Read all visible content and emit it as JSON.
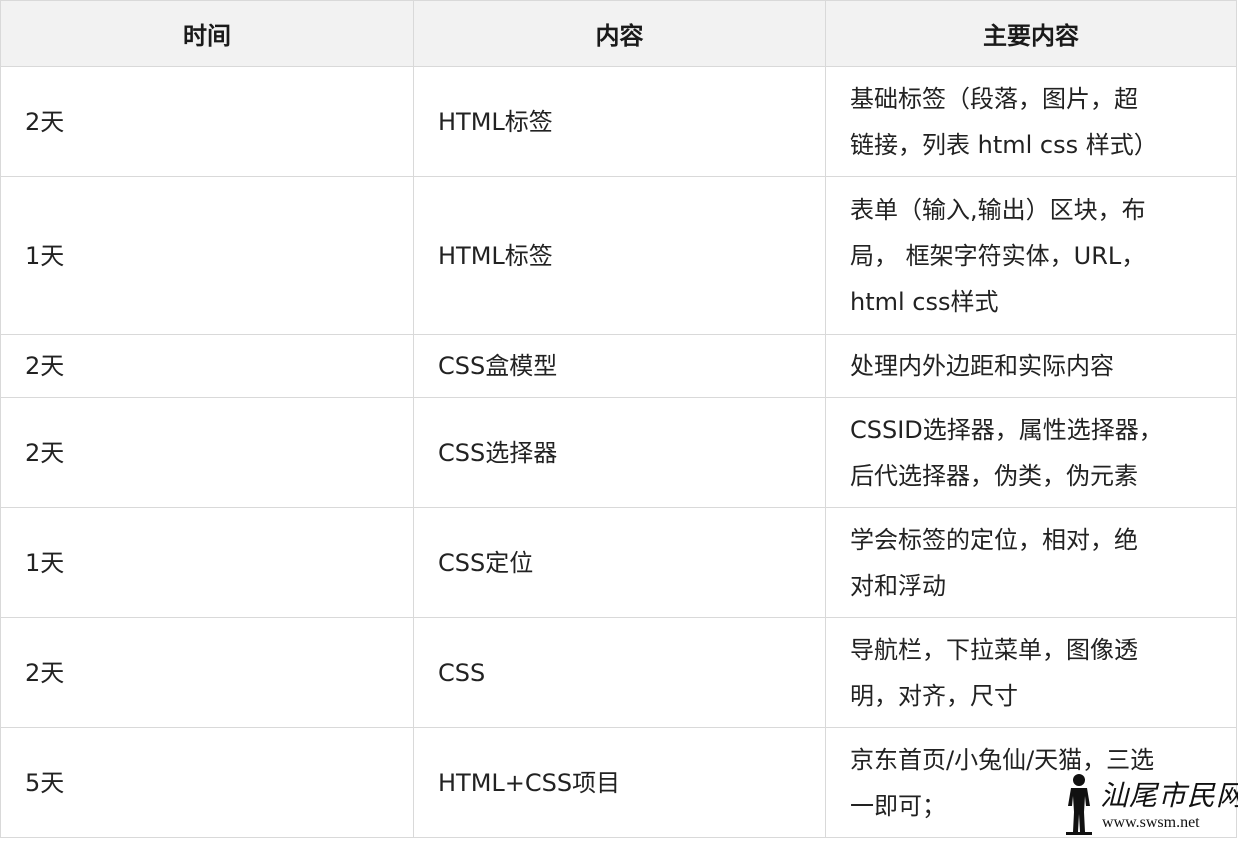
{
  "table": {
    "headers": [
      "时间",
      "内容",
      "主要内容"
    ],
    "rows": [
      {
        "time": "2天",
        "content": "HTML标签",
        "main": [
          "基础标签（段落，图片，超",
          "链接，列表 html css 样式）"
        ]
      },
      {
        "time": "1天",
        "content": "HTML标签",
        "main": [
          "表单（输入,输出）区块，布",
          "局， 框架字符实体，URL，",
          "html css样式"
        ]
      },
      {
        "time": "2天",
        "content": "CSS盒模型",
        "main": [
          "处理内外边距和实际内容"
        ]
      },
      {
        "time": "2天",
        "content": "CSS选择器",
        "main": [
          "CSSID选择器，属性选择器，",
          "后代选择器，伪类，伪元素"
        ]
      },
      {
        "time": "1天",
        "content": "CSS定位",
        "main": [
          "学会标签的定位，相对，绝",
          "对和浮动"
        ]
      },
      {
        "time": "2天",
        "content": "CSS",
        "main": [
          "导航栏，下拉菜单，图像透",
          "明，对齐，尺寸"
        ]
      },
      {
        "time": "5天",
        "content": "HTML+CSS项目",
        "main": [
          "京东首页/小兔仙/天猫，三选",
          "一即可；"
        ]
      }
    ],
    "row_heights": [
      110,
      158,
      63,
      110,
      110,
      110,
      110
    ]
  },
  "watermark": {
    "title": "汕尾市民网",
    "url": "www.swsm.net",
    "figure_icon": "standing-person-silhouette-icon"
  },
  "colors": {
    "header_bg": "#f2f2f2",
    "border": "#d9d9d9",
    "text": "#222222"
  }
}
